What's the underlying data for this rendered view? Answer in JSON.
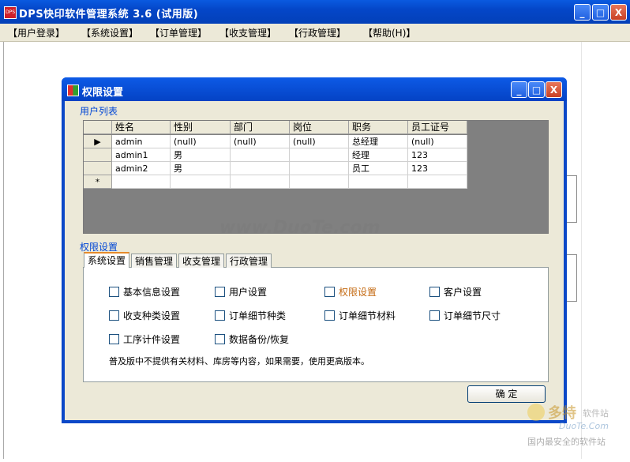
{
  "main_window": {
    "icon_label": "DPS",
    "title": "DPS快印软件管理系统  3.6 (试用版)",
    "controls": {
      "minimize": "_",
      "maximize": "□",
      "close": "X"
    }
  },
  "menu": {
    "items": [
      "【用户登录】",
      "【系统设置】",
      "【订单管理】",
      "【收支管理】",
      "【行政管理】",
      "【帮助(H)】"
    ]
  },
  "dialog": {
    "title": "权限设置",
    "user_list_label": "用户列表",
    "grid": {
      "columns": [
        "姓名",
        "性别",
        "部门",
        "岗位",
        "职务",
        "员工证号"
      ],
      "row_markers": [
        "▶",
        "",
        "",
        "*"
      ],
      "rows": [
        [
          "admin",
          "(null)",
          "(null)",
          "(null)",
          "总经理",
          "(null)"
        ],
        [
          "admin1",
          "男",
          "",
          "",
          "经理",
          "123"
        ],
        [
          "admin2",
          "男",
          "",
          "",
          "员工",
          "123"
        ]
      ]
    },
    "perm_label": "权限设置",
    "tabs": [
      "系统设置",
      "销售管理",
      "收支管理",
      "行政管理"
    ],
    "active_tab": "系统设置",
    "checkboxes": [
      {
        "label": "基本信息设置",
        "checked": false,
        "color": "#000000"
      },
      {
        "label": "用户设置",
        "checked": false,
        "color": "#000000"
      },
      {
        "label": "权限设置",
        "checked": false,
        "color": "#c46a12"
      },
      {
        "label": "客户设置",
        "checked": false,
        "color": "#000000"
      },
      {
        "label": "收支种类设置",
        "checked": false,
        "color": "#000000"
      },
      {
        "label": "订单细节种类",
        "checked": false,
        "color": "#000000"
      },
      {
        "label": "订单细节材料",
        "checked": false,
        "color": "#000000"
      },
      {
        "label": "订单细节尺寸",
        "checked": false,
        "color": "#000000"
      },
      {
        "label": "工序计件设置",
        "checked": false,
        "color": "#000000"
      },
      {
        "label": "数据备份/恢复",
        "checked": false,
        "color": "#000000"
      }
    ],
    "note": "普及版中不提供有关材料、库房等内容，如果需要，使用更高版本。",
    "ok_button": "确   定"
  },
  "watermarks": {
    "center": "www.DuoTe.com",
    "corner_brand": "多特",
    "corner_sub": "软件站",
    "corner_url": "DuoTe.Com",
    "corner_slogan": "国内最安全的软件站"
  },
  "colors": {
    "titlebar": "#0446c8",
    "dialog_border": "#0b48c8",
    "group_label": "#0046d5",
    "active_tab_accent": "#e68b2c"
  }
}
